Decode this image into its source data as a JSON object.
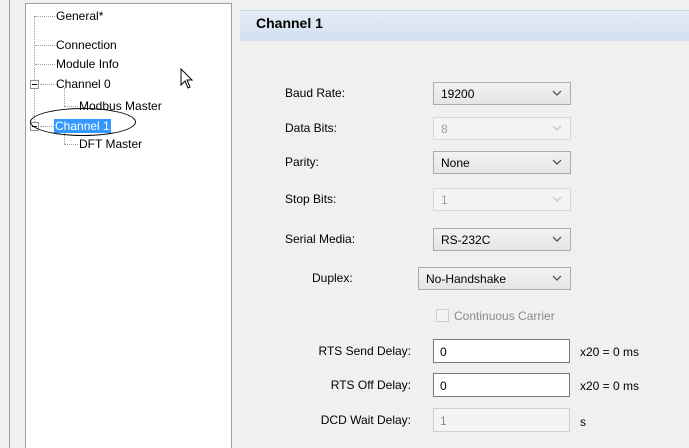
{
  "tree": {
    "items": [
      {
        "label": "General*"
      },
      {
        "label": "Connection"
      },
      {
        "label": "Module Info"
      },
      {
        "label": "Channel 0"
      },
      {
        "label": "Modbus Master"
      },
      {
        "label": "Channel 1"
      },
      {
        "label": "DFT Master"
      }
    ]
  },
  "header": {
    "title": "Channel 1"
  },
  "form": {
    "baud_rate": {
      "label": "Baud Rate:",
      "value": "19200"
    },
    "data_bits": {
      "label": "Data Bits:",
      "value": "8"
    },
    "parity": {
      "label": "Parity:",
      "value": "None"
    },
    "stop_bits": {
      "label": "Stop Bits:",
      "value": "1"
    },
    "serial_media": {
      "label": "Serial Media:",
      "value": "RS-232C"
    },
    "duplex": {
      "label": "Duplex:",
      "value": "No-Handshake"
    },
    "continuous_carrier": {
      "label": "Continuous Carrier",
      "checked": false
    },
    "rts_send_delay": {
      "label": "RTS Send Delay:",
      "value": "0",
      "unit": "x20 = 0 ms"
    },
    "rts_off_delay": {
      "label": "RTS Off Delay:",
      "value": "0",
      "unit": "x20 = 0 ms"
    },
    "dcd_wait_delay": {
      "label": "DCD Wait Delay:",
      "value": "1",
      "unit": "s"
    }
  },
  "icons": {
    "dropdown": "chevron-down-icon",
    "expander": "collapse-minus-icon",
    "cursor": "mouse-pointer-icon"
  },
  "colors": {
    "selection": "#3399ff",
    "header_bg": "#d4e0f0"
  }
}
